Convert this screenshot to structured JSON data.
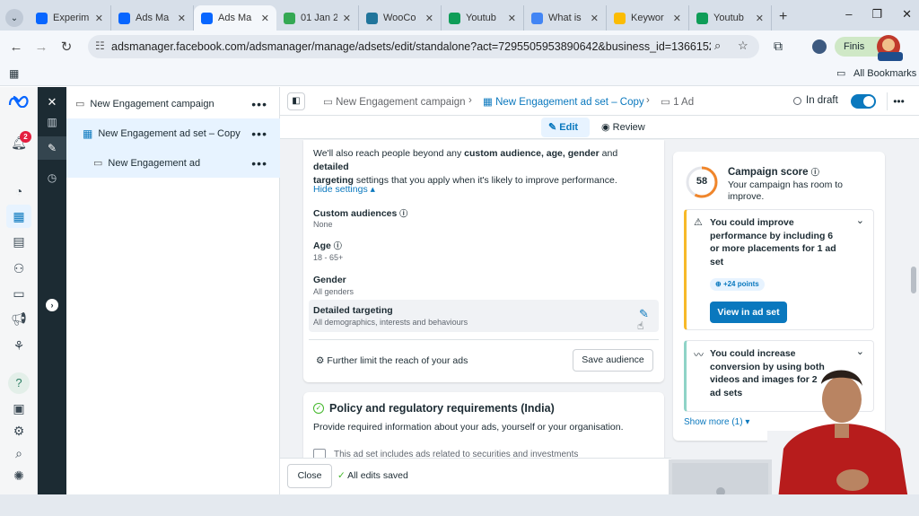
{
  "browser": {
    "tabs": [
      {
        "title": "Experim",
        "favicon": "meta",
        "color": "#0866ff"
      },
      {
        "title": "Ads Ma",
        "favicon": "meta",
        "color": "#0866ff"
      },
      {
        "title": "Ads Ma",
        "favicon": "meta",
        "color": "#0866ff",
        "active": true
      },
      {
        "title": "01 Jan 2",
        "favicon": "drive",
        "color": "#34a853"
      },
      {
        "title": "WooCo",
        "favicon": "wordpress",
        "color": "#21759b"
      },
      {
        "title": "Youtub",
        "favicon": "sheets",
        "color": "#0f9d58"
      },
      {
        "title": "What is",
        "favicon": "google",
        "color": "#4285f4"
      },
      {
        "title": "Keywor",
        "favicon": "ads",
        "color": "#fbbc04"
      },
      {
        "title": "Youtub",
        "favicon": "sheets",
        "color": "#0f9d58"
      }
    ],
    "new_tab": "+",
    "url": "adsmanager.facebook.com/adsmanager/manage/adsets/edit/standalone?act=7295505953890642&business_id=1366152000711229...",
    "profile_button": "Finis",
    "bookmarks_label": "All Bookmarks"
  },
  "rail": {
    "notification_count": "2"
  },
  "tree": {
    "campaign": "New Engagement campaign",
    "adset": "New Engagement ad set – Copy",
    "ad": "New Engagement ad",
    "more": "•••"
  },
  "breadcrumb": {
    "campaign": "New Engagement campaign",
    "adset": "New Engagement ad set – Copy",
    "ad": "1 Ad",
    "status": "In draft"
  },
  "modes": {
    "edit": "Edit",
    "review": "Review"
  },
  "audience": {
    "intro_part1": "We'll also reach people beyond any ",
    "intro_bold1": "custom audience, age, gender",
    "intro_part2": " and ",
    "intro_bold2": "detailed",
    "intro_bold3": "targeting",
    "intro_part3": " settings that you apply when it's likely to improve performance.",
    "hide_settings": "Hide settings ▴",
    "custom_label": "Custom audiences",
    "custom_value": "None",
    "age_label": "Age",
    "age_value": "18 - 65+",
    "gender_label": "Gender",
    "gender_value": "All genders",
    "detailed_label": "Detailed targeting",
    "detailed_value": "All demographics, interests and behaviours",
    "further_limit": "Further limit the reach of your ads",
    "save_audience": "Save audience"
  },
  "policy": {
    "title": "Policy and regulatory requirements (India)",
    "desc": "Provide required information about your ads, yourself or your organisation.",
    "checkbox_label": "This ad set includes ads related to securities and investments"
  },
  "score": {
    "value": "58",
    "title": "Campaign score",
    "desc": "Your campaign has room to improve.",
    "rec1_text": "You could improve performance by including 6 or more placements for 1 ad set",
    "rec1_points": "+24 points",
    "rec1_button": "View in ad set",
    "rec2_text": "You could increase conversion by using both videos and images for 2 ad sets",
    "show_more": "Show more (1) ▾",
    "accent_orange": "#f7b928",
    "accent_teal": "#8fd3c7"
  },
  "footer": {
    "close": "Close",
    "saved": "All edits saved"
  },
  "colors": {
    "primary": "#0a78be",
    "dark_nav": "#1c2b33",
    "selected_bg": "#e7f3ff"
  }
}
